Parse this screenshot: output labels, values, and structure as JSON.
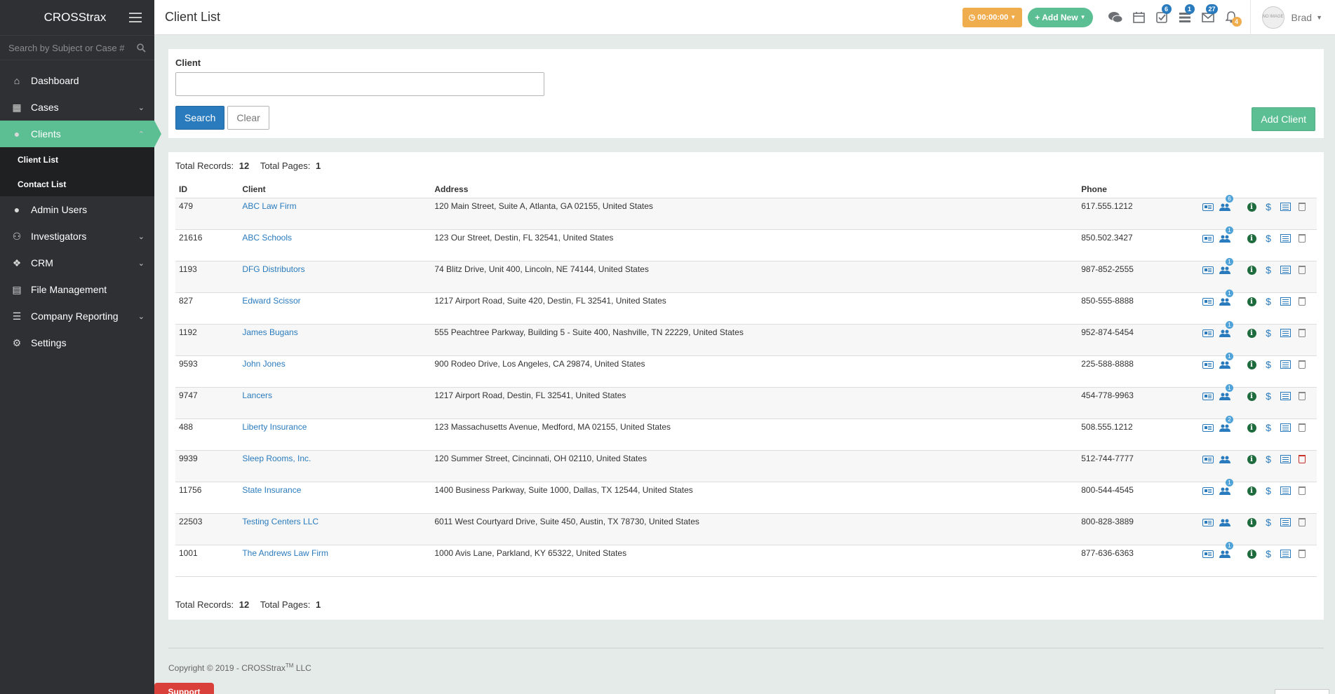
{
  "app": {
    "brand": "CROSStrax"
  },
  "sidebar": {
    "search_placeholder": "Search by Subject or Case #",
    "items": [
      {
        "label": "Dashboard",
        "icon": "home-icon",
        "has_children": false
      },
      {
        "label": "Cases",
        "icon": "grid-icon",
        "has_children": true
      },
      {
        "label": "Clients",
        "icon": "user-icon",
        "has_children": true,
        "active": true
      },
      {
        "label": "Admin Users",
        "icon": "user-icon",
        "has_children": false
      },
      {
        "label": "Investigators",
        "icon": "users-icon",
        "has_children": true
      },
      {
        "label": "CRM",
        "icon": "cubes-icon",
        "has_children": true
      },
      {
        "label": "File Management",
        "icon": "file-icon",
        "has_children": false
      },
      {
        "label": "Company Reporting",
        "icon": "list-icon",
        "has_children": true
      },
      {
        "label": "Settings",
        "icon": "gear-icon",
        "has_children": false
      }
    ],
    "subitems": [
      {
        "label": "Client List"
      },
      {
        "label": "Contact List"
      }
    ]
  },
  "header": {
    "title": "Client List",
    "timer": "00:00:00",
    "add_new": "Add New",
    "badges": {
      "tasks": "6",
      "list": "1",
      "mail": "27",
      "bell": "4"
    },
    "avatar_text": "NO IMAGE",
    "user": "Brad"
  },
  "search": {
    "client_label": "Client",
    "client_value": "",
    "search_button": "Search",
    "clear_button": "Clear",
    "add_client_button": "Add Client"
  },
  "list": {
    "total_records_label": "Total Records:",
    "total_records": "12",
    "total_pages_label": "Total Pages:",
    "total_pages": "1",
    "columns": [
      "ID",
      "Client",
      "Address",
      "Phone"
    ],
    "rows": [
      {
        "id": "479",
        "client": "ABC Law Firm",
        "address": "120 Main Street, Suite A, Atlanta, GA 02155, United States",
        "phone": "617.555.1212",
        "contacts": "6",
        "trash_color": "#888888"
      },
      {
        "id": "21616",
        "client": "ABC Schools",
        "address": "123 Our Street, Destin, FL 32541, United States",
        "phone": "850.502.3427",
        "contacts": "1",
        "trash_color": "#888888"
      },
      {
        "id": "1193",
        "client": "DFG Distributors",
        "address": "74 Blitz Drive, Unit 400, Lincoln, NE 74144, United States",
        "phone": "987-852-2555",
        "contacts": "1",
        "trash_color": "#888888"
      },
      {
        "id": "827",
        "client": "Edward Scissor",
        "address": "1217 Airport Road, Suite 420, Destin, FL 32541, United States",
        "phone": "850-555-8888",
        "contacts": "1",
        "trash_color": "#888888"
      },
      {
        "id": "1192",
        "client": "James Bugans",
        "address": "555 Peachtree Parkway, Building 5 - Suite 400, Nashville, TN 22229, United States",
        "phone": "952-874-5454",
        "contacts": "1",
        "trash_color": "#888888"
      },
      {
        "id": "9593",
        "client": "John Jones",
        "address": "900 Rodeo Drive, Los Angeles, CA 29874, United States",
        "phone": "225-588-8888",
        "contacts": "1",
        "trash_color": "#888888"
      },
      {
        "id": "9747",
        "client": "Lancers",
        "address": "1217 Airport Road, Destin, FL 32541, United States",
        "phone": "454-778-9963",
        "contacts": "1",
        "trash_color": "#888888"
      },
      {
        "id": "488",
        "client": "Liberty Insurance",
        "address": "123 Massachusetts Avenue, Medford, MA 02155, United States",
        "phone": "508.555.1212",
        "contacts": "2",
        "trash_color": "#888888"
      },
      {
        "id": "9939",
        "client": "Sleep Rooms, Inc.",
        "address": "120 Summer Street, Cincinnati, OH 02110, United States",
        "phone": "512-744-7777",
        "contacts": "",
        "trash_color": "#c9302c"
      },
      {
        "id": "11756",
        "client": "State Insurance",
        "address": "1400 Business Parkway, Suite 1000, Dallas, TX 12544, United States",
        "phone": "800-544-4545",
        "contacts": "1",
        "trash_color": "#888888"
      },
      {
        "id": "22503",
        "client": "Testing Centers LLC",
        "address": "6011 West Courtyard Drive, Suite 450, Austin, TX 78730, United States",
        "phone": "800-828-3889",
        "contacts": "",
        "trash_color": "#888888"
      },
      {
        "id": "1001",
        "client": "The Andrews Law Firm",
        "address": "1000 Avis Lane, Parkland, KY 65322, United States",
        "phone": "877-636-6363",
        "contacts": "1",
        "trash_color": "#888888"
      }
    ]
  },
  "footer": {
    "copyright": "Copyright © 2019 - CROSStrax",
    "tm": "TM",
    "suffix": "LLC"
  },
  "support_label": "Support",
  "colors": {
    "accent": "#5cbf93",
    "primary": "#2a7bbd",
    "sidebar": "#2e3033",
    "timer": "#f0ad4e",
    "support": "#d9403a"
  }
}
